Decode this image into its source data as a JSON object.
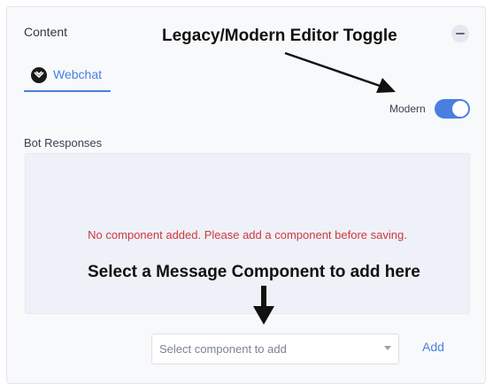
{
  "panel": {
    "title": "Content",
    "collapse_icon": "minus-icon",
    "tab": {
      "label": "Webchat",
      "icon": "webchat-logo-icon",
      "active": true
    },
    "editor_toggle": {
      "label": "Modern",
      "state": "on",
      "color": "#4a7fe0"
    },
    "responses": {
      "label": "Bot Responses",
      "empty_message": "No component added. Please add a component before saving."
    },
    "component_select": {
      "placeholder": "Select component to add",
      "caret_icon": "caret-down-icon"
    },
    "add_label": "Add"
  },
  "annotations": {
    "toggle_note": "Legacy/Modern Editor Toggle",
    "component_note": "Select a Message Component to add here"
  },
  "colors": {
    "accent": "#4a7fe0",
    "error": "#d0393e",
    "panel_bg": "#f8f9fb"
  }
}
